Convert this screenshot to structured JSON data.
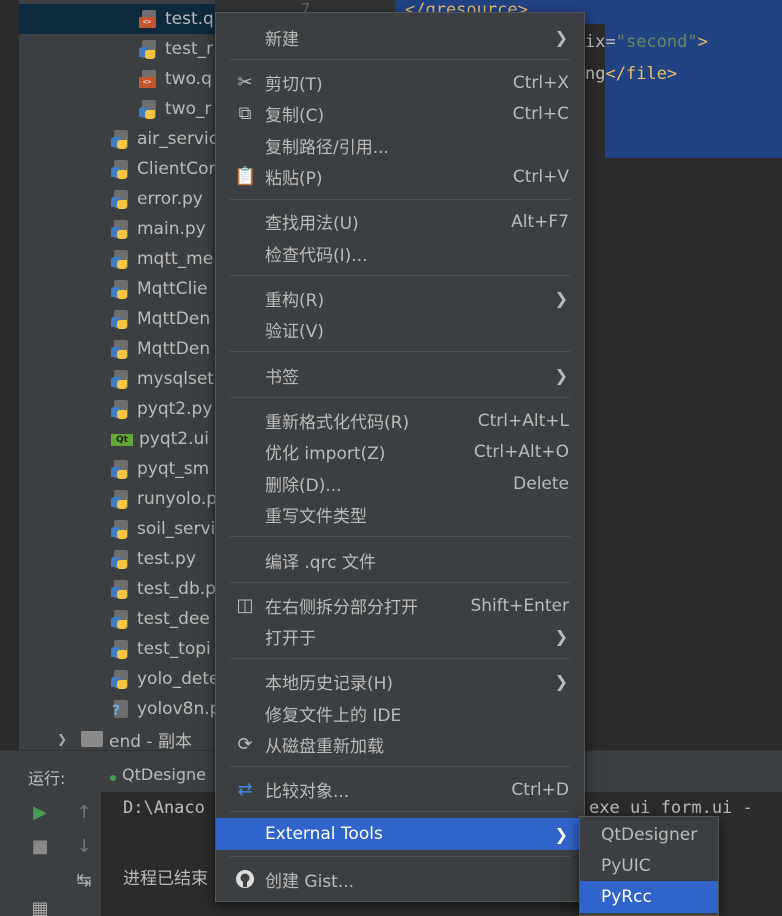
{
  "tree": {
    "items": [
      {
        "label": "test.q",
        "icon": "qrc",
        "sel": true
      },
      {
        "label": "test_r",
        "icon": "py"
      },
      {
        "label": "two.q",
        "icon": "qrc"
      },
      {
        "label": "two_r",
        "icon": "py"
      },
      {
        "label": "air_servic",
        "icon": "py"
      },
      {
        "label": "ClientCor",
        "icon": "py"
      },
      {
        "label": "error.py",
        "icon": "py"
      },
      {
        "label": "main.py",
        "icon": "py"
      },
      {
        "label": "mqtt_me",
        "icon": "py"
      },
      {
        "label": "MqttClie",
        "icon": "py"
      },
      {
        "label": "MqttDen",
        "icon": "py"
      },
      {
        "label": "MqttDen",
        "icon": "py"
      },
      {
        "label": "mysqlset",
        "icon": "py"
      },
      {
        "label": "pyqt2.py",
        "icon": "py"
      },
      {
        "label": "pyqt2.ui",
        "icon": "qt"
      },
      {
        "label": "pyqt_sm",
        "icon": "py"
      },
      {
        "label": "runyolo.p",
        "icon": "py"
      },
      {
        "label": "soil_servi",
        "icon": "py"
      },
      {
        "label": "test.py",
        "icon": "py"
      },
      {
        "label": "test_db.p",
        "icon": "py"
      },
      {
        "label": "test_dee",
        "icon": "py"
      },
      {
        "label": "test_topi",
        "icon": "py"
      },
      {
        "label": "yolo_dete",
        "icon": "py"
      },
      {
        "label": "yolov8n.p",
        "icon": "unknown"
      }
    ],
    "folder": {
      "label": "end - 副本"
    }
  },
  "editor": {
    "line_number": "7",
    "line1": "</qresource>",
    "line2_attr": "ix=",
    "line2_str": "\"second\"",
    "line2_end": ">",
    "line3_text": "ng",
    "line3_tag": "</file>"
  },
  "run": {
    "label": "运行:",
    "tab_label": "QtDesigne",
    "console_line1": "D:\\Anaco",
    "console_line1_tail": "exe ui_form.ui -",
    "console_line2": "进程已结束"
  },
  "menu": {
    "items": [
      {
        "label": "新建",
        "shortcut": "",
        "arrow": true,
        "icon": ""
      },
      {
        "label": "剪切(T)",
        "shortcut": "Ctrl+X",
        "icon": "scissors-icon"
      },
      {
        "label": "复制(C)",
        "shortcut": "Ctrl+C",
        "icon": "copy-icon"
      },
      {
        "label": "复制路径/引用...",
        "shortcut": "",
        "icon": ""
      },
      {
        "label": "粘贴(P)",
        "shortcut": "Ctrl+V",
        "icon": "paste-icon"
      },
      {
        "label": "查找用法(U)",
        "shortcut": "Alt+F7",
        "icon": ""
      },
      {
        "label": "检查代码(I)...",
        "shortcut": "",
        "icon": ""
      },
      {
        "label": "重构(R)",
        "shortcut": "",
        "arrow": true,
        "icon": ""
      },
      {
        "label": "验证(V)",
        "shortcut": "",
        "icon": ""
      },
      {
        "label": "书签",
        "shortcut": "",
        "arrow": true,
        "icon": ""
      },
      {
        "label": "重新格式化代码(R)",
        "shortcut": "Ctrl+Alt+L",
        "icon": ""
      },
      {
        "label": "优化 import(Z)",
        "shortcut": "Ctrl+Alt+O",
        "icon": ""
      },
      {
        "label": "删除(D)...",
        "shortcut": "Delete",
        "icon": ""
      },
      {
        "label": "重写文件类型",
        "shortcut": "",
        "icon": ""
      },
      {
        "label": "编译 .qrc 文件",
        "shortcut": "",
        "icon": ""
      },
      {
        "label": "在右侧拆分部分打开",
        "shortcut": "Shift+Enter",
        "icon": "split-icon"
      },
      {
        "label": "打开于",
        "shortcut": "",
        "arrow": true,
        "icon": ""
      },
      {
        "label": "本地历史记录(H)",
        "shortcut": "",
        "arrow": true,
        "icon": ""
      },
      {
        "label": "修复文件上的 IDE",
        "shortcut": "",
        "icon": ""
      },
      {
        "label": "从磁盘重新加载",
        "shortcut": "",
        "icon": "reload-icon"
      },
      {
        "label": "比较对象...",
        "shortcut": "Ctrl+D",
        "icon": "compare-icon"
      },
      {
        "label": "External Tools",
        "shortcut": "",
        "arrow": true,
        "icon": "",
        "highlighted": true
      },
      {
        "label": "创建 Gist...",
        "shortcut": "",
        "icon": "github-icon"
      }
    ]
  },
  "submenu": {
    "items": [
      {
        "label": "QtDesigner"
      },
      {
        "label": "PyUIC"
      },
      {
        "label": "PyRcc",
        "highlighted": true
      }
    ]
  },
  "colors": {
    "menu_bg": "#3c3f41",
    "highlight": "#2f65ca",
    "editor_bg": "#2b2b2b",
    "selection": "#214283"
  }
}
